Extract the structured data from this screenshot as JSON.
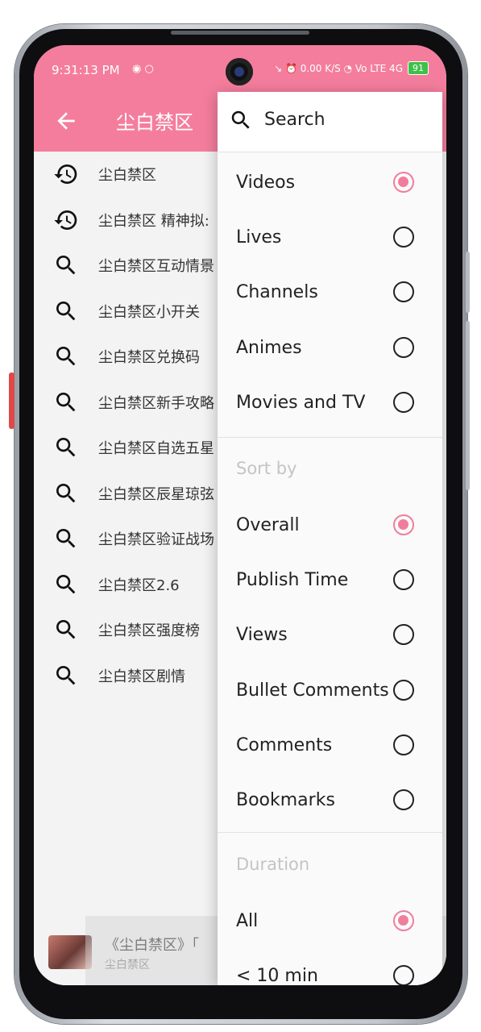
{
  "status_bar": {
    "time": "9:31:13 PM",
    "left_icons": "◉ ○",
    "right_icons": "↘ ⏰ 0.00 K/S ◔ Vo LTE 4G",
    "battery": "91"
  },
  "app_bar": {
    "title": "尘白禁区"
  },
  "suggestions": [
    {
      "icon": "history-icon",
      "text": "尘白禁区"
    },
    {
      "icon": "history-icon",
      "text": "尘白禁区 精神拟:"
    },
    {
      "icon": "search-icon",
      "text": "尘白禁区互动情景"
    },
    {
      "icon": "search-icon",
      "text": "尘白禁区小开关"
    },
    {
      "icon": "search-icon",
      "text": "尘白禁区兑换码"
    },
    {
      "icon": "search-icon",
      "text": "尘白禁区新手攻略"
    },
    {
      "icon": "search-icon",
      "text": "尘白禁区自选五星"
    },
    {
      "icon": "search-icon",
      "text": "尘白禁区辰星琼弦"
    },
    {
      "icon": "search-icon",
      "text": "尘白禁区验证战场"
    },
    {
      "icon": "search-icon",
      "text": "尘白禁区2.6"
    },
    {
      "icon": "search-icon",
      "text": "尘白禁区强度榜"
    },
    {
      "icon": "search-icon",
      "text": "尘白禁区剧情"
    }
  ],
  "mini_player": {
    "title": "《尘白禁区》「",
    "subtitle": "尘白禁区"
  },
  "menu": {
    "search_label": "Search",
    "type_options": [
      {
        "label": "Videos",
        "checked": true
      },
      {
        "label": "Lives",
        "checked": false
      },
      {
        "label": "Channels",
        "checked": false
      },
      {
        "label": "Animes",
        "checked": false
      },
      {
        "label": "Movies and TV",
        "checked": false
      }
    ],
    "sort_header": "Sort by",
    "sort_options": [
      {
        "label": "Overall",
        "checked": true
      },
      {
        "label": "Publish Time",
        "checked": false
      },
      {
        "label": "Views",
        "checked": false
      },
      {
        "label": "Bullet Comments",
        "checked": false
      },
      {
        "label": "Comments",
        "checked": false
      },
      {
        "label": "Bookmarks",
        "checked": false
      }
    ],
    "duration_header": "Duration",
    "duration_options": [
      {
        "label": "All",
        "checked": true
      },
      {
        "label": "< 10 min",
        "checked": false
      }
    ]
  },
  "colors": {
    "accent": "#f47d9d",
    "radio_checked": "#ef7e9c"
  }
}
